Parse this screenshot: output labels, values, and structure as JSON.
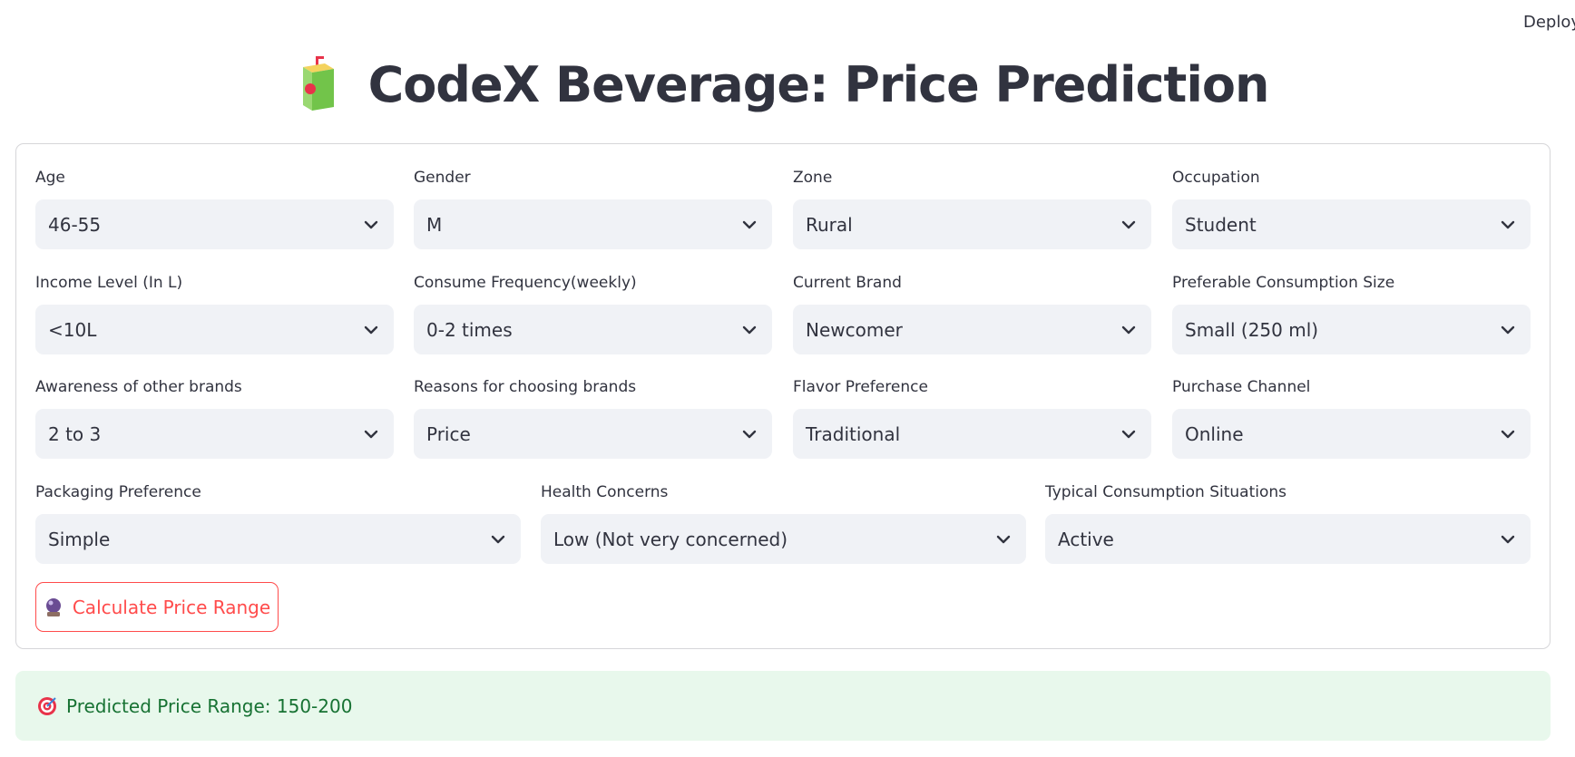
{
  "header": {
    "deploy_label": "Deploy",
    "title": "CodeX Beverage: Price Prediction",
    "title_icon": "beverage-carton-icon"
  },
  "form": {
    "fields": [
      {
        "label": "Age",
        "value": "46-55"
      },
      {
        "label": "Gender",
        "value": "M"
      },
      {
        "label": "Zone",
        "value": "Rural"
      },
      {
        "label": "Occupation",
        "value": "Student"
      },
      {
        "label": "Income Level (In L)",
        "value": "<10L"
      },
      {
        "label": "Consume Frequency(weekly)",
        "value": "0-2 times"
      },
      {
        "label": "Current Brand",
        "value": "Newcomer"
      },
      {
        "label": "Preferable Consumption Size",
        "value": "Small (250 ml)"
      },
      {
        "label": "Awareness of other brands",
        "value": "2 to 3"
      },
      {
        "label": "Reasons for choosing brands",
        "value": "Price"
      },
      {
        "label": "Flavor Preference",
        "value": "Traditional"
      },
      {
        "label": "Purchase Channel",
        "value": "Online"
      },
      {
        "label": "Packaging Preference",
        "value": "Simple"
      },
      {
        "label": "Health Concerns",
        "value": "Low (Not very concerned)"
      },
      {
        "label": "Typical Consumption Situations",
        "value": "Active"
      }
    ],
    "submit_label": "Calculate Price Range",
    "submit_icon": "crystal-ball-icon"
  },
  "result": {
    "text": "Predicted Price Range: 150-200",
    "icon": "target-icon"
  },
  "colors": {
    "accent": "#ff4b4b",
    "text": "#31333f",
    "select_bg": "#f0f2f6",
    "success_bg": "#e8f8ec",
    "success_text": "#177233"
  }
}
